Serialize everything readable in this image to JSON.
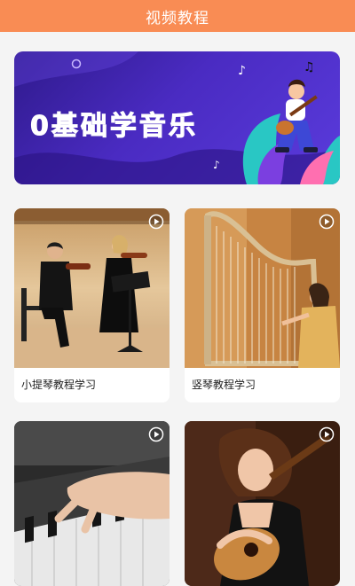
{
  "header": {
    "title": "视频教程"
  },
  "banner": {
    "title": "0基础学音乐"
  },
  "cards": [
    {
      "caption": "小提琴教程学习"
    },
    {
      "caption": "竖琴教程学习"
    },
    {
      "caption": ""
    },
    {
      "caption": ""
    }
  ],
  "colors": {
    "header": "#f98c54",
    "banner": "#4a2bc2",
    "accent_play": "#ffffff"
  },
  "icons": {
    "play": "play-circle-icon"
  }
}
